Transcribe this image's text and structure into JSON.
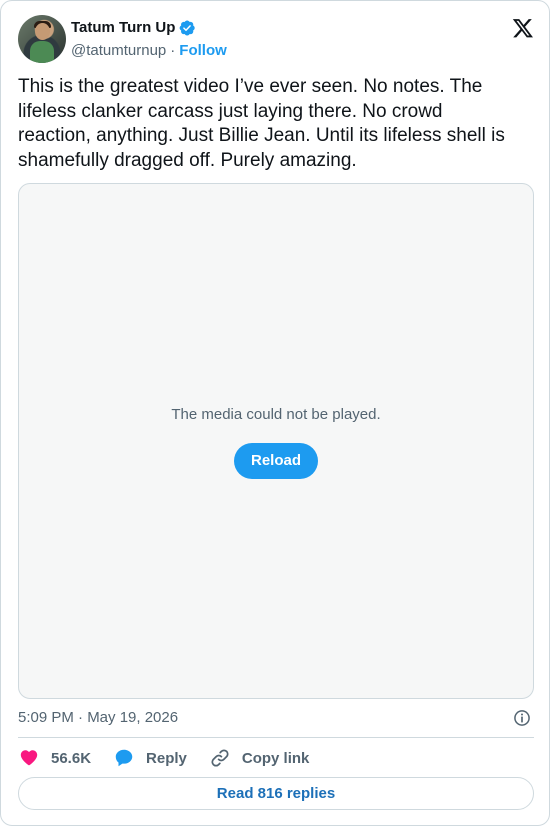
{
  "author": {
    "name": "Tatum Turn Up",
    "handle": "@tatumturnup",
    "separator": "·",
    "follow_label": "Follow"
  },
  "tweet": {
    "text": "This is the greatest video I’ve ever seen. No notes. The lifeless clanker carcass just laying there. No crowd reaction, anything. Just Billie Jean. Until its lifeless shell is shamefully dragged off. Purely amazing."
  },
  "media": {
    "error_message": "The media could not be played.",
    "reload_label": "Reload"
  },
  "meta": {
    "timestamp": "5:09 PM · May 19, 2026"
  },
  "actions": {
    "likes_count": "56.6K",
    "reply_label": "Reply",
    "copy_link_label": "Copy link"
  },
  "footer": {
    "read_replies_label": "Read 816 replies"
  },
  "colors": {
    "accent": "#1d9bf0",
    "like": "#f91880",
    "secondary_text": "#536471",
    "border": "#cfd9de"
  },
  "icons": [
    "verified-badge-icon",
    "x-logo-icon",
    "info-icon",
    "heart-icon",
    "reply-bubble-icon",
    "link-icon"
  ]
}
